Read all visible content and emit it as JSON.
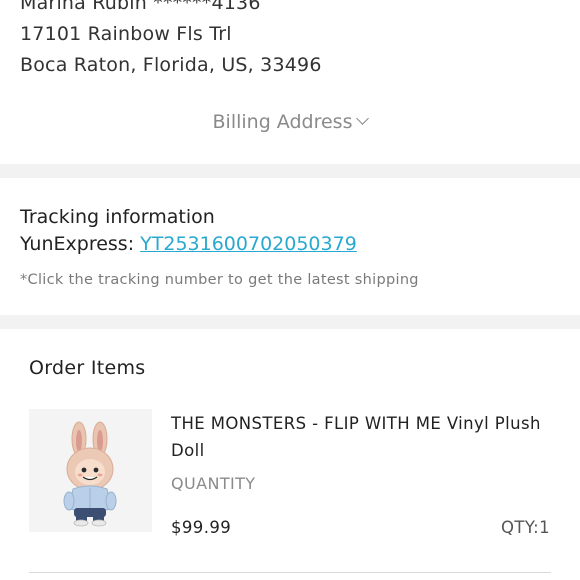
{
  "shipping_address": {
    "name_line": "Marina Rubin ******4136",
    "street": "17101 Rainbow Fls Trl",
    "city_line": "Boca Raton, Florida, US, 33496"
  },
  "billing_toggle_label": "Billing Address",
  "tracking": {
    "title": "Tracking information",
    "carrier": "YunExpress:",
    "number": "YT2531600702050379",
    "note": "*Click the tracking number to get the latest shipping"
  },
  "order_items": {
    "title": "Order Items",
    "items": [
      {
        "name": "THE MONSTERS - FLIP WITH ME Vinyl Plush Doll",
        "quantity_label": "QUANTITY",
        "price": "$99.99",
        "qty": "QTY:1"
      }
    ]
  }
}
